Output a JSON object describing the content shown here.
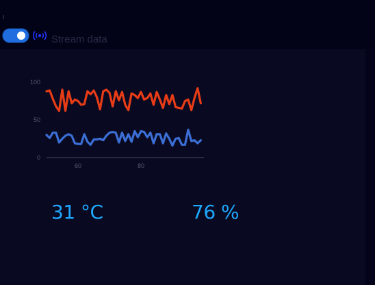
{
  "header": {
    "stream_toggle": {
      "on": true
    },
    "stream_icon": "broadcast-icon",
    "stream_label": "Stream data"
  },
  "chart_data": {
    "type": "line",
    "x_ticks": [
      60,
      80
    ],
    "y_ticks": [
      0,
      50,
      100
    ],
    "xlim": [
      50,
      100
    ],
    "ylim": [
      0,
      100
    ],
    "grid": false,
    "series": [
      {
        "color": "#e83c17",
        "x": [
          50,
          51,
          52,
          53,
          54,
          55,
          56,
          57,
          58,
          59,
          60,
          61,
          62,
          63,
          64,
          65,
          66,
          67,
          68,
          69,
          70,
          71,
          72,
          73,
          74,
          75,
          76,
          77,
          78,
          79,
          80,
          81,
          82,
          83,
          84,
          85,
          86,
          87,
          88,
          89,
          90,
          91,
          92,
          93,
          94,
          95,
          96,
          97,
          98,
          99
        ],
        "values": [
          88,
          89,
          78,
          68,
          62,
          90,
          62,
          88,
          72,
          77,
          75,
          70,
          71,
          88,
          84,
          89,
          80,
          64,
          88,
          90,
          86,
          68,
          88,
          76,
          87,
          70,
          63,
          85,
          83,
          79,
          87,
          77,
          79,
          85,
          70,
          87,
          77,
          66,
          83,
          71,
          83,
          67,
          66,
          65,
          75,
          77,
          63,
          79,
          92,
          72
        ]
      },
      {
        "color": "#3c6fd6",
        "x": [
          50,
          51,
          52,
          53,
          54,
          55,
          56,
          57,
          58,
          59,
          60,
          61,
          62,
          63,
          64,
          65,
          66,
          67,
          68,
          69,
          70,
          71,
          72,
          73,
          74,
          75,
          76,
          77,
          78,
          79,
          80,
          81,
          82,
          83,
          84,
          85,
          86,
          87,
          88,
          89,
          90,
          91,
          92,
          93,
          94,
          95,
          96,
          97,
          98,
          99
        ],
        "values": [
          30,
          26,
          33,
          33,
          20,
          25,
          29,
          31,
          29,
          19,
          18,
          18,
          31,
          21,
          17,
          24,
          24,
          25,
          23,
          29,
          33,
          34,
          33,
          20,
          33,
          22,
          31,
          21,
          35,
          27,
          35,
          34,
          27,
          33,
          19,
          31,
          31,
          19,
          32,
          25,
          16,
          25,
          26,
          17,
          17,
          37,
          22,
          23,
          19,
          23
        ]
      }
    ]
  },
  "readouts": {
    "temperature": "31 °C",
    "humidity": "76 %"
  }
}
